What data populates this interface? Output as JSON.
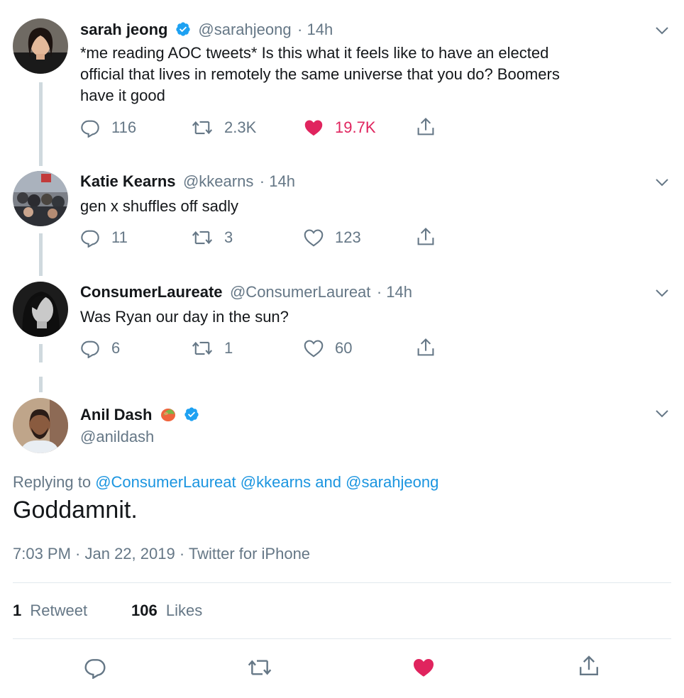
{
  "tweets": [
    {
      "name": "sarah jeong",
      "handle": "@sarahjeong",
      "time": "· 14h",
      "text_lines": [
        "*me reading AOC tweets*  Is this what it feels like to have an elected",
        "official that lives in remotely the same universe that you do? Boomers",
        "have it good"
      ],
      "replies": "116",
      "retweets": "2.3K",
      "likes": "19.7K"
    },
    {
      "name": "Katie Kearns",
      "handle": "@kkearns",
      "time": "· 14h",
      "text": "gen x shuffles off sadly",
      "replies": "11",
      "retweets": "3",
      "likes": "123"
    },
    {
      "name": "ConsumerLaureate",
      "handle": "@ConsumerLaureat",
      "time": "· 14h",
      "text": "Was Ryan our day in the sun?",
      "replies": "6",
      "retweets": "1",
      "likes": "60"
    }
  ],
  "main": {
    "name": "Anil Dash",
    "handle": "@anildash",
    "replying_prefix": "Replying to",
    "replying_user1": "@ConsumerLaureat",
    "replying_user2": "@kkearns",
    "replying_and": "and",
    "replying_user3": "@sarahjeong",
    "text": "Goddamnit.",
    "meta": "7:03 PM · Jan 22, 2019 · Twitter for iPhone",
    "retweet_count": "1",
    "retweet_label": "Retweet",
    "like_count": "106",
    "like_label": "Likes"
  },
  "colors": {
    "accent": "#1da1f2",
    "like": "#e0245e",
    "secondary_text": "#657786"
  },
  "icons": [
    "reply-icon",
    "retweet-icon",
    "like-icon",
    "share-icon",
    "chevron-down-icon",
    "verified-badge-icon",
    "mango-emoji-icon"
  ]
}
